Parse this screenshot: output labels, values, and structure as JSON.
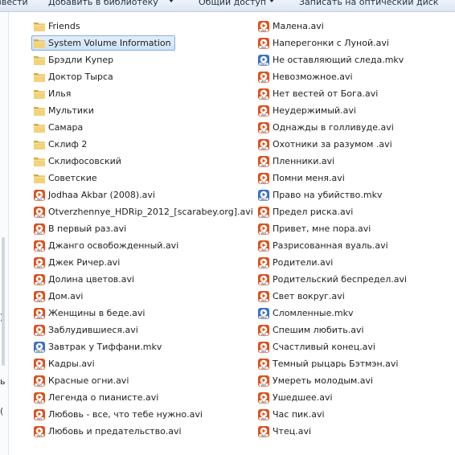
{
  "toolbar": {
    "items": [
      "звести",
      "Добавить в библиотеку",
      "Общий доступ",
      "Записать на оптический диск"
    ]
  },
  "navpane": {
    "glyphs": [
      ")",
      "ь",
      "("
    ]
  },
  "columns": [
    {
      "items": [
        {
          "label": "Friends",
          "icon": "folder-icon"
        },
        {
          "label": "System Volume Information",
          "icon": "folder-icon",
          "selected": true
        },
        {
          "label": "Брэдли Купер",
          "icon": "folder-icon"
        },
        {
          "label": "Доктор Тырса",
          "icon": "folder-icon"
        },
        {
          "label": "Илья",
          "icon": "folder-icon"
        },
        {
          "label": "Мультики",
          "icon": "folder-icon"
        },
        {
          "label": "Самара",
          "icon": "folder-icon"
        },
        {
          "label": "Склиф 2",
          "icon": "folder-icon"
        },
        {
          "label": "Склифосовский",
          "icon": "folder-icon"
        },
        {
          "label": "Советские",
          "icon": "folder-icon"
        },
        {
          "label": "Jodhaa Akbar (2008).avi",
          "icon": "avi-file-icon"
        },
        {
          "label": "Otverzhennye_HDRip_2012_[scarabey.org].avi",
          "icon": "avi-file-icon"
        },
        {
          "label": "В первый раз.avi",
          "icon": "avi-file-icon"
        },
        {
          "label": "Джанго освобожденный.avi",
          "icon": "avi-file-icon"
        },
        {
          "label": "Джек Ричер.avi",
          "icon": "avi-file-icon"
        },
        {
          "label": "Долина цветов.avi",
          "icon": "avi-file-icon"
        },
        {
          "label": "Дом.avi",
          "icon": "avi-file-icon"
        },
        {
          "label": "Женщины в беде.avi",
          "icon": "avi-file-icon"
        },
        {
          "label": "Заблудившиеся.avi",
          "icon": "avi-file-icon"
        },
        {
          "label": "Завтрак у Тиффани.mkv",
          "icon": "mkv-file-icon"
        },
        {
          "label": "Кадры.avi",
          "icon": "avi-file-icon"
        },
        {
          "label": "Красные огни.avi",
          "icon": "avi-file-icon"
        },
        {
          "label": "Легенда о пианисте.avi",
          "icon": "avi-file-icon"
        },
        {
          "label": "Любовь - все, что тебе нужно.avi",
          "icon": "avi-file-icon"
        },
        {
          "label": "Любовь и предательство.avi",
          "icon": "avi-file-icon"
        }
      ]
    },
    {
      "items": [
        {
          "label": "Малена.avi",
          "icon": "avi-file-icon"
        },
        {
          "label": "Наперегонки с Луной.avi",
          "icon": "avi-file-icon"
        },
        {
          "label": "Не оставляющий следа.mkv",
          "icon": "mkv-file-icon"
        },
        {
          "label": "Невозможное.avi",
          "icon": "avi-file-icon"
        },
        {
          "label": "Нет вестей от Бога.avi",
          "icon": "avi-file-icon"
        },
        {
          "label": "Неудержимый.avi",
          "icon": "avi-file-icon"
        },
        {
          "label": "Однажды в голливуде.avi",
          "icon": "avi-file-icon"
        },
        {
          "label": "Охотники за разумом .avi",
          "icon": "avi-file-icon"
        },
        {
          "label": "Пленники.avi",
          "icon": "avi-file-icon"
        },
        {
          "label": "Помни меня.avi",
          "icon": "avi-file-icon"
        },
        {
          "label": "Право на убийство.mkv",
          "icon": "mkv-file-icon"
        },
        {
          "label": "Предел риска.avi",
          "icon": "avi-file-icon"
        },
        {
          "label": "Привет, мне пора.avi",
          "icon": "avi-file-icon"
        },
        {
          "label": "Разрисованная вуаль.avi",
          "icon": "avi-file-icon"
        },
        {
          "label": "Родители.avi",
          "icon": "avi-file-icon"
        },
        {
          "label": "Родительский беспредел.avi",
          "icon": "avi-file-icon"
        },
        {
          "label": "Свет вокруг.avi",
          "icon": "avi-file-icon"
        },
        {
          "label": "Сломленные.mkv",
          "icon": "mkv-file-icon"
        },
        {
          "label": "Спешим любить.avi",
          "icon": "avi-file-icon"
        },
        {
          "label": "Счастливый конец.avi",
          "icon": "avi-file-icon"
        },
        {
          "label": "Темный рыцарь Бэтмэн.avi",
          "icon": "avi-file-icon"
        },
        {
          "label": "Умереть молодым.avi",
          "icon": "avi-file-icon"
        },
        {
          "label": "Ушедшее.avi",
          "icon": "avi-file-icon"
        },
        {
          "label": "Час пик.avi",
          "icon": "avi-file-icon"
        },
        {
          "label": "Чтец.avi",
          "icon": "avi-file-icon"
        }
      ]
    }
  ],
  "colors": {
    "folder": "#e8c15a",
    "selection": "#cfe2f8",
    "avi_badge": "#d9531e",
    "mkv_badge": "#3a6fc7"
  }
}
